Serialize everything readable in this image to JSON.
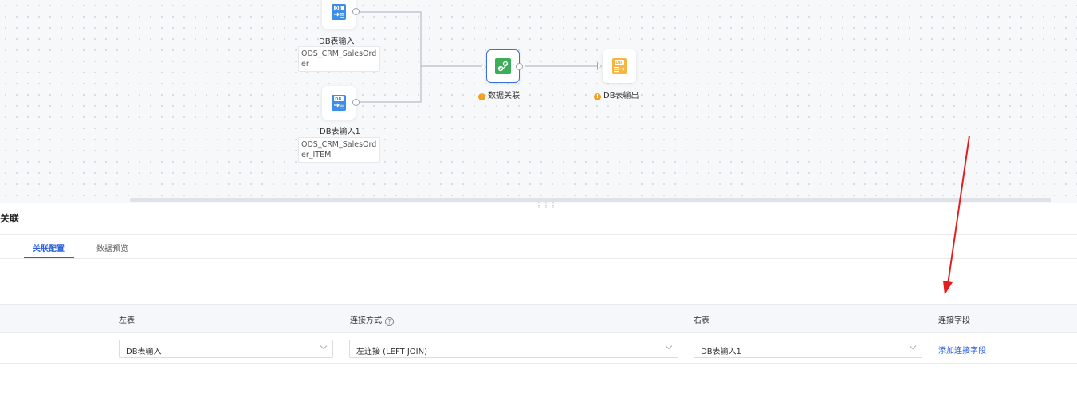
{
  "canvas": {
    "nodes": [
      {
        "name": "DB表输入",
        "table": "ODS_CRM_SalesOrder"
      },
      {
        "name": "DB表输入1",
        "table": "ODS_CRM_SalesOrder_ITEM"
      },
      {
        "name": "数据关联"
      },
      {
        "name": "DB表输出"
      }
    ]
  },
  "panel": {
    "title": "关联",
    "tabs": [
      "关联配置",
      "数据预览"
    ],
    "active_tab": "关联配置"
  },
  "table": {
    "headers": {
      "left": "左表",
      "join_type": "连接方式",
      "right": "右表",
      "join_field": "连接字段"
    },
    "row": {
      "left": "DB表输入",
      "join_type": "左连接 (LEFT JOIN)",
      "right": "DB表输入1",
      "add_field": "添加连接字段"
    }
  },
  "colors": {
    "accent": "#2e62d9",
    "warning": "#f0a020",
    "annotation_arrow": "#e02020"
  }
}
